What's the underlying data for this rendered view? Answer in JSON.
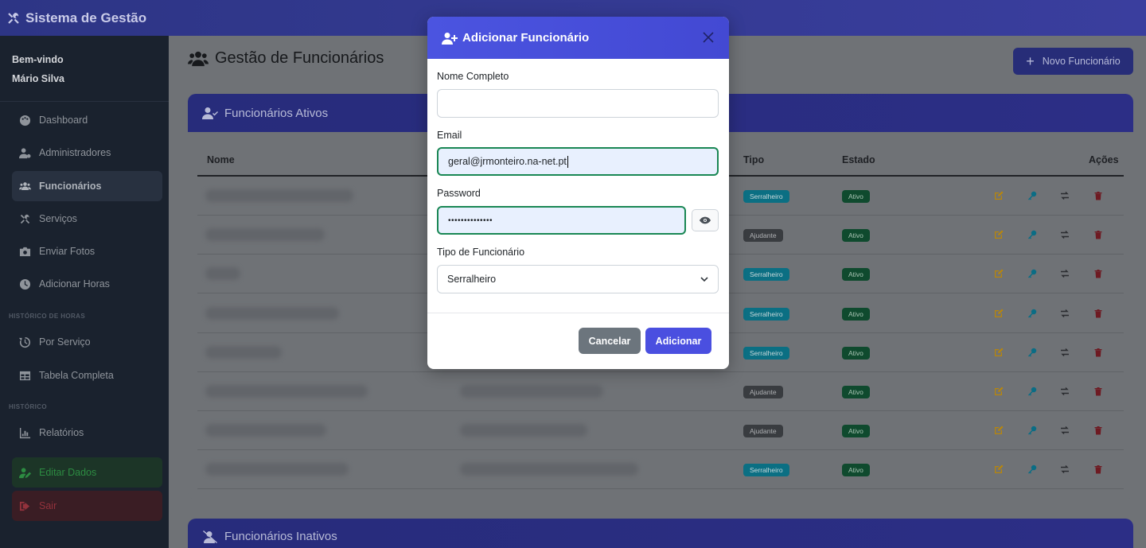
{
  "navbar": {
    "brand": "Sistema de Gestão"
  },
  "sidebar": {
    "welcome": "Bem-vindo",
    "user_name": "Mário Silva",
    "items": [
      {
        "label": "Dashboard",
        "icon": "palette-icon"
      },
      {
        "label": "Administradores",
        "icon": "user-cog-icon"
      },
      {
        "label": "Funcionários",
        "icon": "users-icon",
        "active": true
      },
      {
        "label": "Serviços",
        "icon": "tools-icon"
      },
      {
        "label": "Enviar Fotos",
        "icon": "camera-icon"
      },
      {
        "label": "Adicionar Horas",
        "icon": "clock-icon"
      }
    ],
    "section_hours": "HISTÓRICO DE HORAS",
    "hours_items": [
      {
        "label": "Por Serviço",
        "icon": "history-icon"
      },
      {
        "label": "Tabela Completa",
        "icon": "table-icon"
      }
    ],
    "section_history": "HISTÓRICO",
    "history_items": [
      {
        "label": "Relatórios",
        "icon": "chart-icon"
      }
    ],
    "edit_label": "Editar Dados",
    "logout_label": "Sair"
  },
  "main": {
    "title": "Gestão de Funcionários",
    "new_button": "Novo Funcionário",
    "active_card_title": "Funcionários Ativos",
    "inactive_card_title": "Funcionários Inativos",
    "columns": {
      "name": "Nome",
      "type": "Tipo",
      "status": "Estado",
      "actions": "Ações"
    },
    "rows": [
      {
        "type": "Serralheiro",
        "status": "Ativo"
      },
      {
        "type": "Ajudante",
        "status": "Ativo"
      },
      {
        "type": "Serralheiro",
        "status": "Ativo"
      },
      {
        "type": "Serralheiro",
        "status": "Ativo"
      },
      {
        "type": "Serralheiro",
        "status": "Ativo"
      },
      {
        "type": "Ajudante",
        "status": "Ativo"
      },
      {
        "type": "Ajudante",
        "status": "Ativo"
      },
      {
        "type": "Serralheiro",
        "status": "Ativo"
      }
    ]
  },
  "modal": {
    "title": "Adicionar Funcionário",
    "name_label": "Nome Completo",
    "name_value": "",
    "email_label": "Email",
    "email_value": "geral@jrmonteiro.na-net.pt",
    "password_label": "Password",
    "password_value": "••••••••••••••",
    "type_label": "Tipo de Funcionário",
    "type_value": "Serralheiro",
    "cancel_label": "Cancelar",
    "add_label": "Adicionar"
  },
  "colors": {
    "primary": "#4a4fe0",
    "sidebar_bg": "#1a222e",
    "badge_serralheiro": "#0dcaf0",
    "badge_ajudante": "#6c757d",
    "badge_ativo": "#198754",
    "valid_border": "#198754"
  }
}
